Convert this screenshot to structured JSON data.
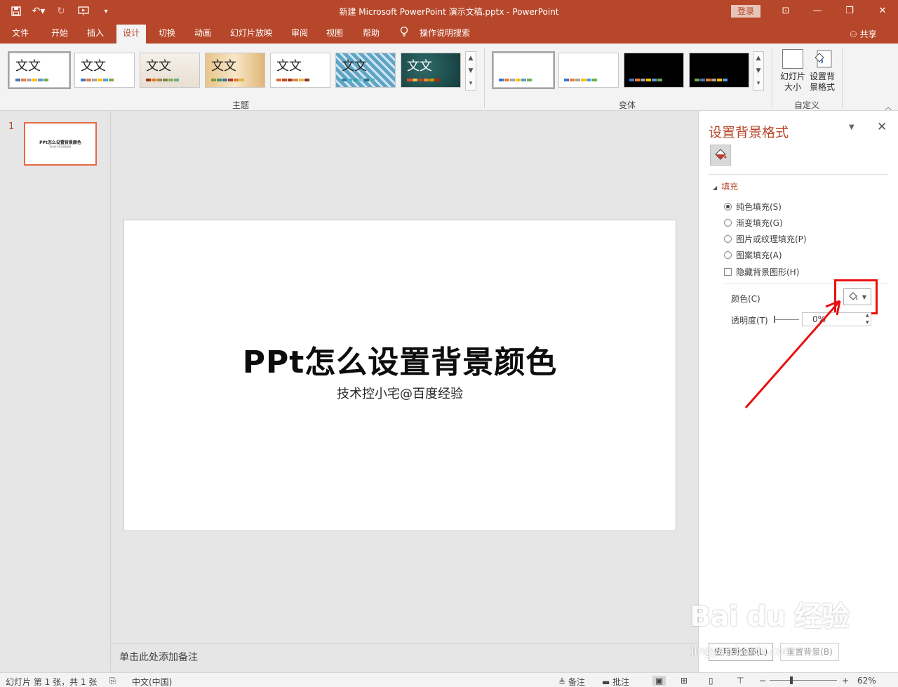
{
  "window": {
    "title": "新建 Microsoft PowerPoint 演示文稿.pptx  -  PowerPoint",
    "login_label": "登录",
    "share_label": "共享"
  },
  "tabs": [
    {
      "label": "文件"
    },
    {
      "label": "开始"
    },
    {
      "label": "插入"
    },
    {
      "label": "设计"
    },
    {
      "label": "切换"
    },
    {
      "label": "动画"
    },
    {
      "label": "幻灯片放映"
    },
    {
      "label": "审阅"
    },
    {
      "label": "视图"
    },
    {
      "label": "帮助"
    },
    {
      "label": "操作说明搜索"
    }
  ],
  "active_tab": "设计",
  "ribbon": {
    "themes_group_label": "主题",
    "variants_group_label": "变体",
    "customize_group_label": "自定义",
    "theme_thumb_text": "文文",
    "slide_size_label": "幻灯片大小",
    "format_bg_label": "设置背景格式"
  },
  "slides_pane": {
    "slide_number": "1",
    "thumb_title": "PPt怎么设置背景颜色",
    "thumb_subtitle": "技术控小宅@百度经验"
  },
  "slide": {
    "title": "PPt怎么设置背景颜色",
    "subtitle": "技术控小宅@百度经验"
  },
  "notes": {
    "placeholder": "单击此处添加备注"
  },
  "format_pane": {
    "title": "设置背景格式",
    "section": "填充",
    "options": [
      {
        "label": "纯色填充(S)",
        "selected": true
      },
      {
        "label": "渐变填充(G)",
        "selected": false
      },
      {
        "label": "图片或纹理填充(P)",
        "selected": false
      },
      {
        "label": "图案填充(A)",
        "selected": false
      }
    ],
    "hide_bg_label": "隐藏背景图形(H)",
    "hide_bg_checked": false,
    "color_label": "颜色(C)",
    "transparency_label": "透明度(T)",
    "transparency_value": "0%",
    "apply_all_label": "应用到全部(L)",
    "reset_label": "重置背景(B)"
  },
  "status": {
    "slide_info": "幻灯片 第 1 张，共 1 张",
    "language": "中文(中国)",
    "notes_label": "备注",
    "comments_label": "批注",
    "zoom": "62%"
  },
  "watermark": {
    "brand": "Bai du 经验",
    "url": "jingyan.baidu.com"
  },
  "colors": {
    "accent": "#b7472a",
    "highlight": "#e8100f"
  }
}
